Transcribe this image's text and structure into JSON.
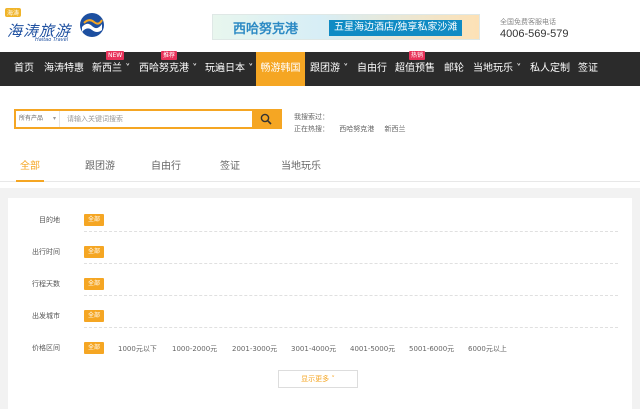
{
  "header": {
    "logo_badge": "海涛",
    "logo_text": "海涛旅游",
    "logo_sub": "Haitao Travel",
    "banner_title": "西哈努克港",
    "banner_sub": "五星海边酒店/独享私家沙滩",
    "hotline_label": "全国免费客服电话",
    "hotline_number": "4006-569-579"
  },
  "nav": {
    "items": [
      {
        "label": "首页"
      },
      {
        "label": "海涛特惠"
      },
      {
        "label": "新西兰",
        "badge": "NEW"
      },
      {
        "label": "西哈努克港",
        "badge": "推荐"
      },
      {
        "label": "玩遍日本"
      },
      {
        "label": "畅游韩国",
        "active": true
      },
      {
        "label": "跟团游"
      },
      {
        "label": "自由行"
      },
      {
        "label": "超值预售",
        "badge": "热销"
      },
      {
        "label": "邮轮"
      },
      {
        "label": "当地玩乐"
      },
      {
        "label": "私人定制"
      },
      {
        "label": "签证"
      }
    ],
    "caret": "˅"
  },
  "search": {
    "category": "所有产品",
    "placeholder": "请输入关键词搜索",
    "history_label": "我搜索过：",
    "hot_label": "正在热搜：",
    "hot_tags": [
      "西哈努克港",
      "新西兰"
    ]
  },
  "tabs": [
    {
      "label": "全部",
      "active": true
    },
    {
      "label": "跟团游"
    },
    {
      "label": "自由行"
    },
    {
      "label": "签证"
    },
    {
      "label": "当地玩乐"
    }
  ],
  "filters": {
    "all_label": "全部",
    "rows": [
      {
        "label": "目的地"
      },
      {
        "label": "出行时间"
      },
      {
        "label": "行程天数"
      },
      {
        "label": "出发城市"
      },
      {
        "label": "价格区间"
      }
    ],
    "price_options": [
      "1000元以下",
      "1000-2000元",
      "2001-3000元",
      "3001-4000元",
      "4001-5000元",
      "5001-6000元",
      "6000元以上"
    ],
    "show_more": "显示更多 ˅"
  },
  "colors": {
    "accent": "#f5a623",
    "nav_bg": "#2b2b2b",
    "badge": "#e8335a"
  }
}
